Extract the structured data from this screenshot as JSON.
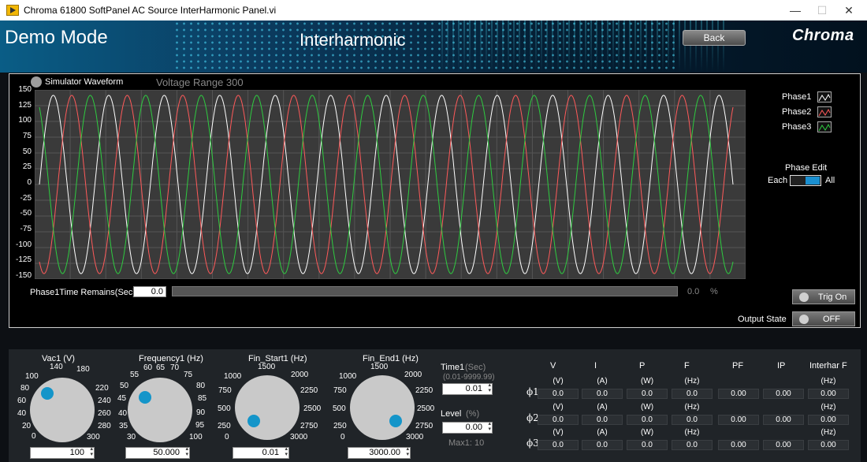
{
  "window": {
    "title": "Chroma 61800 SoftPanel AC Source InterHarmonic Panel.vi",
    "controls": [
      "—",
      "☐",
      "✕"
    ]
  },
  "header": {
    "mode": "Demo Mode",
    "title": "Interharmonic",
    "back_label": "Back",
    "brand": "Chroma"
  },
  "graph": {
    "sim_label": "Simulator Waveform",
    "voltage_range": "Voltage Range 300",
    "y_ticks": [
      "150",
      "125",
      "100",
      "75",
      "50",
      "25",
      "0",
      "-25",
      "-50",
      "-75",
      "-100",
      "-125",
      "-150"
    ],
    "legend": [
      {
        "name": "Phase1",
        "color": "#ffffff"
      },
      {
        "name": "Phase2",
        "color": "#ff5a5a"
      },
      {
        "name": "Phase3",
        "color": "#2ecc40"
      }
    ],
    "phase_edit": {
      "title": "Phase Edit",
      "left": "Each",
      "right": "All"
    }
  },
  "chart_data": {
    "type": "line",
    "ylim": [
      -150,
      150
    ],
    "grid": true,
    "legend_position": "right",
    "series": [
      {
        "name": "Phase1",
        "color": "#ffffff",
        "amplitude": 141.4,
        "cycles": 12.5,
        "phase_deg": 0
      },
      {
        "name": "Phase2",
        "color": "#ff5a5a",
        "amplitude": 141.4,
        "cycles": 12.5,
        "phase_deg": -120
      },
      {
        "name": "Phase3",
        "color": "#2ecc40",
        "amplitude": 141.4,
        "cycles": 12.5,
        "phase_deg": 120
      }
    ]
  },
  "time_remains": {
    "label": "Phase1Time Remains(Sec)",
    "value": "0.0",
    "percent": "0.0",
    "percent_unit": "%",
    "progress": 0
  },
  "trig": {
    "label": "Trig On"
  },
  "output": {
    "label": "Output State",
    "value": "OFF"
  },
  "knobs": [
    {
      "label": "Vac1  (V)",
      "value": "100",
      "level": 0.333,
      "scale": [
        [
          "0",
          ""
        ],
        [
          "20",
          ""
        ],
        [
          "40",
          ""
        ],
        [
          "60",
          ""
        ],
        [
          "80",
          ""
        ],
        [
          "100",
          ""
        ],
        [
          "140",
          ""
        ],
        [
          "180",
          ""
        ],
        [
          "220",
          ""
        ],
        [
          "240",
          ""
        ],
        [
          "260",
          ""
        ],
        [
          "280",
          ""
        ],
        [
          "300",
          ""
        ]
      ]
    },
    {
      "label": "Frequency1 (Hz)",
      "value": "50.000",
      "level": 0.286,
      "scale": []
    },
    {
      "label": "Fin_Start1 (Hz)",
      "value": "0.01",
      "level": 0.0,
      "scale": []
    },
    {
      "label": "Fin_End1 (Hz)",
      "value": "3000.00",
      "level": 1.0,
      "scale": []
    }
  ],
  "knob_scales": {
    "vac": [
      "0",
      "20",
      "40",
      "60",
      "80",
      "100",
      "140",
      "180",
      "220",
      "240",
      "260",
      "280",
      "300"
    ],
    "freq": [
      "30",
      "35",
      "40",
      "45",
      "50",
      "55",
      "60",
      "65",
      "70",
      "75",
      "80",
      "85",
      "90",
      "95",
      "100"
    ],
    "fin": [
      "0",
      "250",
      "500",
      "750",
      "1000",
      "1500",
      "2000",
      "2250",
      "2500",
      "2750",
      "3000"
    ]
  },
  "time1": {
    "label": "Time1",
    "unit": "(Sec)",
    "range": "(0.01-9999.99)",
    "value": "0.01"
  },
  "level": {
    "label": "Level",
    "unit": "(%)",
    "value": "0.00",
    "max": "Max1: 10"
  },
  "meas": {
    "headers": [
      "V",
      "I",
      "P",
      "F",
      "PF",
      "IP",
      "Interhar F"
    ],
    "rows": [
      {
        "phi": "ϕ1",
        "units": [
          "(V)",
          "(A)",
          "(W)",
          "(Hz)",
          "",
          "",
          "(Hz)"
        ],
        "values": [
          "0.0",
          "0.0",
          "0.0",
          "0.0",
          "0.00",
          "0.00",
          "0.00"
        ]
      },
      {
        "phi": "ϕ2",
        "units": [
          "(V)",
          "(A)",
          "(W)",
          "(Hz)",
          "",
          "",
          "(Hz)"
        ],
        "values": [
          "0.0",
          "0.0",
          "0.0",
          "0.0",
          "0.00",
          "0.00",
          "0.00"
        ]
      },
      {
        "phi": "ϕ3",
        "units": [
          "(V)",
          "(A)",
          "(W)",
          "(Hz)",
          "",
          "",
          "(Hz)"
        ],
        "values": [
          "0.0",
          "0.0",
          "0.0",
          "0.0",
          "0.00",
          "0.00",
          "0.00"
        ]
      }
    ]
  }
}
